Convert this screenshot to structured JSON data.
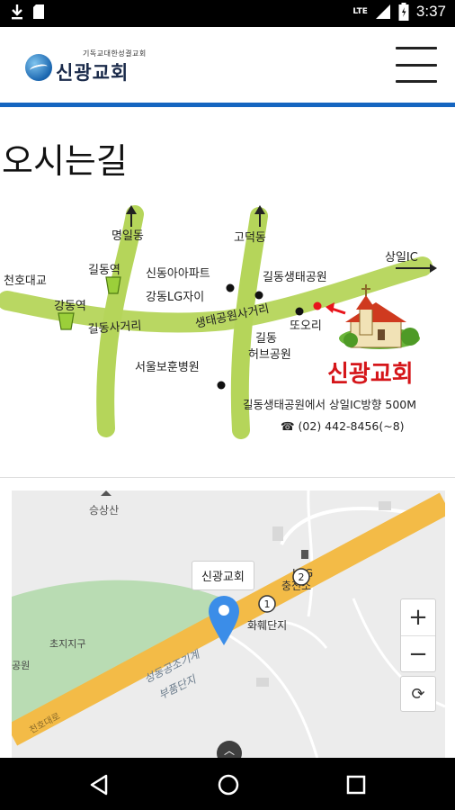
{
  "status_bar": {
    "time": "3:37",
    "network": "LTE",
    "icons": [
      "download-icon",
      "sd-card-icon",
      "signal-icon",
      "battery-icon"
    ]
  },
  "header": {
    "logo_subtitle": "기독교대한성결교회",
    "logo_title": "신광교회",
    "accent_color": "#1565c0"
  },
  "page": {
    "title": "오시는길"
  },
  "directions": {
    "labels": {
      "myeongil": "명일동",
      "godeok": "고덕동",
      "sangil_ic": "상일IC",
      "cheonho_bridge": "천호대교",
      "gildong_station_top": "길동역",
      "gangdong_station": "강동역",
      "gildong_intersection": "길동사거리",
      "sindong_apt": "신동아아파트",
      "gangdong_lg": "강동LG자이",
      "ecopark": "길동생태공원",
      "ecopark_intersection": "생태공원사거리",
      "ttori": "또오리",
      "gildong": "길동",
      "herb_park": "허브공원",
      "seoul_hospital": "서울보훈병원"
    },
    "church_name": "신광교회",
    "direction_note": "길동생태공원에서 상일IC방향 500M",
    "phone": "☎ (02) 442-8456(~8)"
  },
  "map": {
    "place_label": "신광교회",
    "labels": {
      "mountain": "승상산",
      "district": "초지지구",
      "complex": "화훼단지",
      "gas_station": "충전소",
      "lpg": "LPG",
      "industrial_1": "성동공조기계",
      "industrial_2": "부품단지",
      "road": "천호대로",
      "park": "공원"
    },
    "route_markers": [
      "1",
      "2"
    ],
    "zoom_in": "+",
    "zoom_out": "−",
    "refresh": "⟳",
    "expand": "︿"
  }
}
